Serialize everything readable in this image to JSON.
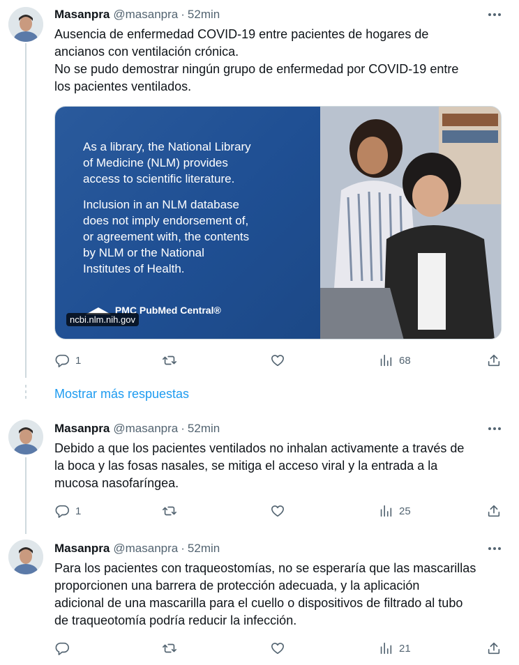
{
  "tweets": [
    {
      "name": "Masanpra",
      "handle": "@masanpra",
      "separator": "·",
      "time": "52min",
      "text": "Ausencia de enfermedad COVID-19 entre pacientes de hogares de\nancianos con ventilación crónica.\nNo se pudo demostrar ningún grupo de enfermedad por COVID-19 entre\nlos pacientes ventilados.",
      "card": {
        "paragraph1": "As a library, the National Library\nof Medicine (NLM) provides\naccess to scientific literature.",
        "paragraph2": "Inclusion in an NLM database\ndoes not imply endorsement of,\nor agreement with, the contents\nby NLM or the National\nInstitutes of Health.",
        "logo_text": "PMC PubMed Central®",
        "domain": "ncbi.nlm.nih.gov"
      },
      "replies": "1",
      "views": "68"
    },
    {
      "name": "Masanpra",
      "handle": "@masanpra",
      "separator": "·",
      "time": "52min",
      "text": "Debido a que los pacientes ventilados no inhalan activamente a través de\nla boca y las fosas nasales, se mitiga el acceso viral y la entrada a la\nmucosa nasofaríngea.",
      "replies": "1",
      "views": "25"
    },
    {
      "name": "Masanpra",
      "handle": "@masanpra",
      "separator": "·",
      "time": "52min",
      "text": "Para los pacientes con traqueostomías, no se esperaría que las mascarillas\nproporcionen una barrera de protección adecuada, y la aplicación\nadicional de una mascarilla para el cuello o dispositivos de filtrado al tubo\nde traqueotomía podría reducir la infección.",
      "replies": "",
      "views": "21"
    }
  ],
  "show_more_replies": "Mostrar más respuestas",
  "colors": {
    "accent": "#1d9bf0",
    "muted": "#536471",
    "text": "#0f1419",
    "line": "#cfd9de",
    "card_blue": "#1f4f93"
  },
  "icons": [
    "reply-icon",
    "retweet-icon",
    "like-icon",
    "views-icon",
    "share-icon",
    "more-icon"
  ]
}
